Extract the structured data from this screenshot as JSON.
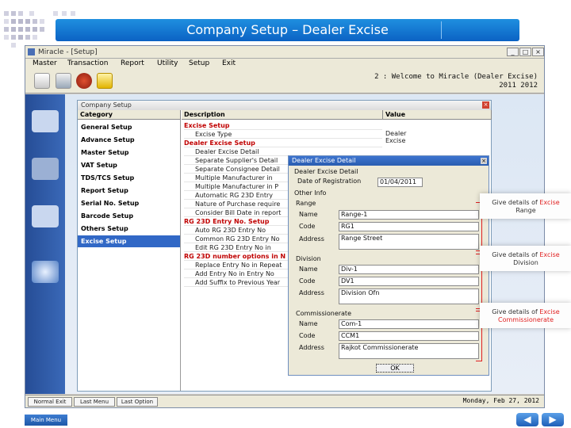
{
  "banner": {
    "title": "Company Setup – Dealer Excise"
  },
  "window": {
    "title": "Miracle - [Setup]",
    "min": "_",
    "max": "□",
    "close": "×",
    "menu": [
      "Master",
      "Transaction",
      "Report",
      "Utility",
      "Setup",
      "Exit"
    ],
    "welcome_line1": "2 : Welcome to Miracle (Dealer Excise)",
    "welcome_line2": "2011 2012"
  },
  "statusbar": {
    "buttons": [
      "Normal Exit",
      "Last Menu",
      "Last Option"
    ],
    "date": "Monday, Feb 27, 2012"
  },
  "company_setup": {
    "title": "Company Setup",
    "close": "×",
    "headers": {
      "category": "Category",
      "description": "Description",
      "value": "Value"
    },
    "categories": [
      "General Setup",
      "Advance Setup",
      "Master Setup",
      "VAT Setup",
      "TDS/TCS Setup",
      "Report Setup",
      "Serial No. Setup",
      "Barcode Setup",
      "Others Setup",
      "Excise Setup"
    ],
    "rows": [
      {
        "text": "Excise Setup",
        "kind": "head"
      },
      {
        "text": "Excise Type",
        "kind": "item",
        "value": "Dealer Excise"
      },
      {
        "text": "Dealer Excise Setup",
        "kind": "head"
      },
      {
        "text": "Dealer Excise Detail",
        "kind": "item"
      },
      {
        "text": "Separate Supplier's Detail",
        "kind": "item"
      },
      {
        "text": "Separate Consignee Detail",
        "kind": "item"
      },
      {
        "text": "Multiple Manufacturer in",
        "kind": "item"
      },
      {
        "text": "Multiple Manufacturer in P",
        "kind": "item"
      },
      {
        "text": "Automatic RG 23D Entry",
        "kind": "item"
      },
      {
        "text": "Nature of Purchase require",
        "kind": "item"
      },
      {
        "text": "Consider Bill Date in report",
        "kind": "item"
      },
      {
        "text": "RG 23D Entry No. Setup",
        "kind": "head"
      },
      {
        "text": "Auto RG 23D Entry No",
        "kind": "item"
      },
      {
        "text": "Common RG 23D Entry No",
        "kind": "item"
      },
      {
        "text": "Edit RG 23D Entry No in",
        "kind": "item"
      },
      {
        "text": "RG 23D number options in N",
        "kind": "head"
      },
      {
        "text": "Replace Entry No in Repeat",
        "kind": "item"
      },
      {
        "text": "Add Entry No in Entry No",
        "kind": "item"
      },
      {
        "text": "Add Suffix to Previous Year",
        "kind": "item"
      }
    ]
  },
  "dealer_dialog": {
    "title": "Dealer Excise Detail",
    "close": "×",
    "section_detail": "Dealer Excise Detail",
    "date_label": "Date of Registration",
    "date_value": "01/04/2011",
    "other_info": "Other Info",
    "range": {
      "label": "Range",
      "name_label": "Name",
      "name": "Range-1",
      "code_label": "Code",
      "code": "RG1",
      "address_label": "Address",
      "address": "Range Street"
    },
    "division": {
      "label": "Division",
      "name_label": "Name",
      "name": "Div-1",
      "code_label": "Code",
      "code": "DV1",
      "address_label": "Address",
      "address": "Division Ofn"
    },
    "commissionerate": {
      "label": "Commissionerate",
      "name_label": "Name",
      "name": "Com-1",
      "code_label": "Code",
      "code": "CCM1",
      "address_label": "Address",
      "address": "Rajkot Commissionerate"
    },
    "ok": "OK"
  },
  "callouts": {
    "range": {
      "prefix": "Give details of ",
      "highlight": "Excise",
      "suffix": "Range"
    },
    "division": {
      "prefix": "Give details of ",
      "highlight": "Excise",
      "suffix": "Division"
    },
    "commissionerate": {
      "prefix": "Give details of ",
      "highlight": "Excise",
      "suffix": "Commissionerate"
    }
  },
  "footer": {
    "main_menu": "Main Menu",
    "prev": "◀",
    "next": "▶"
  },
  "colors": {
    "accent": "#1f8fe0",
    "highlight_red": "#e02020",
    "selection": "#3168c6"
  }
}
